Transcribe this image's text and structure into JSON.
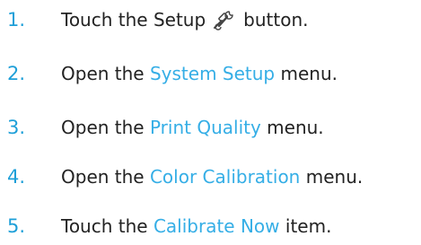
{
  "steps": [
    {
      "number": "1.",
      "before": "Touch the Setup",
      "icon": "setup-wrench-screwdriver-icon",
      "after": "button."
    },
    {
      "number": "2.",
      "before": "Open the",
      "link": "System Setup",
      "after": "menu."
    },
    {
      "number": "3.",
      "before": "Open the",
      "link": "Print Quality",
      "after": "menu."
    },
    {
      "number": "4.",
      "before": "Open the",
      "link": "Color Calibration",
      "after": "menu."
    },
    {
      "number": "5.",
      "before": "Touch the",
      "link": "Calibrate Now",
      "after": "item."
    }
  ],
  "colors": {
    "step_number": "#1e9fd8",
    "link": "#35aee6",
    "text": "#222222"
  }
}
